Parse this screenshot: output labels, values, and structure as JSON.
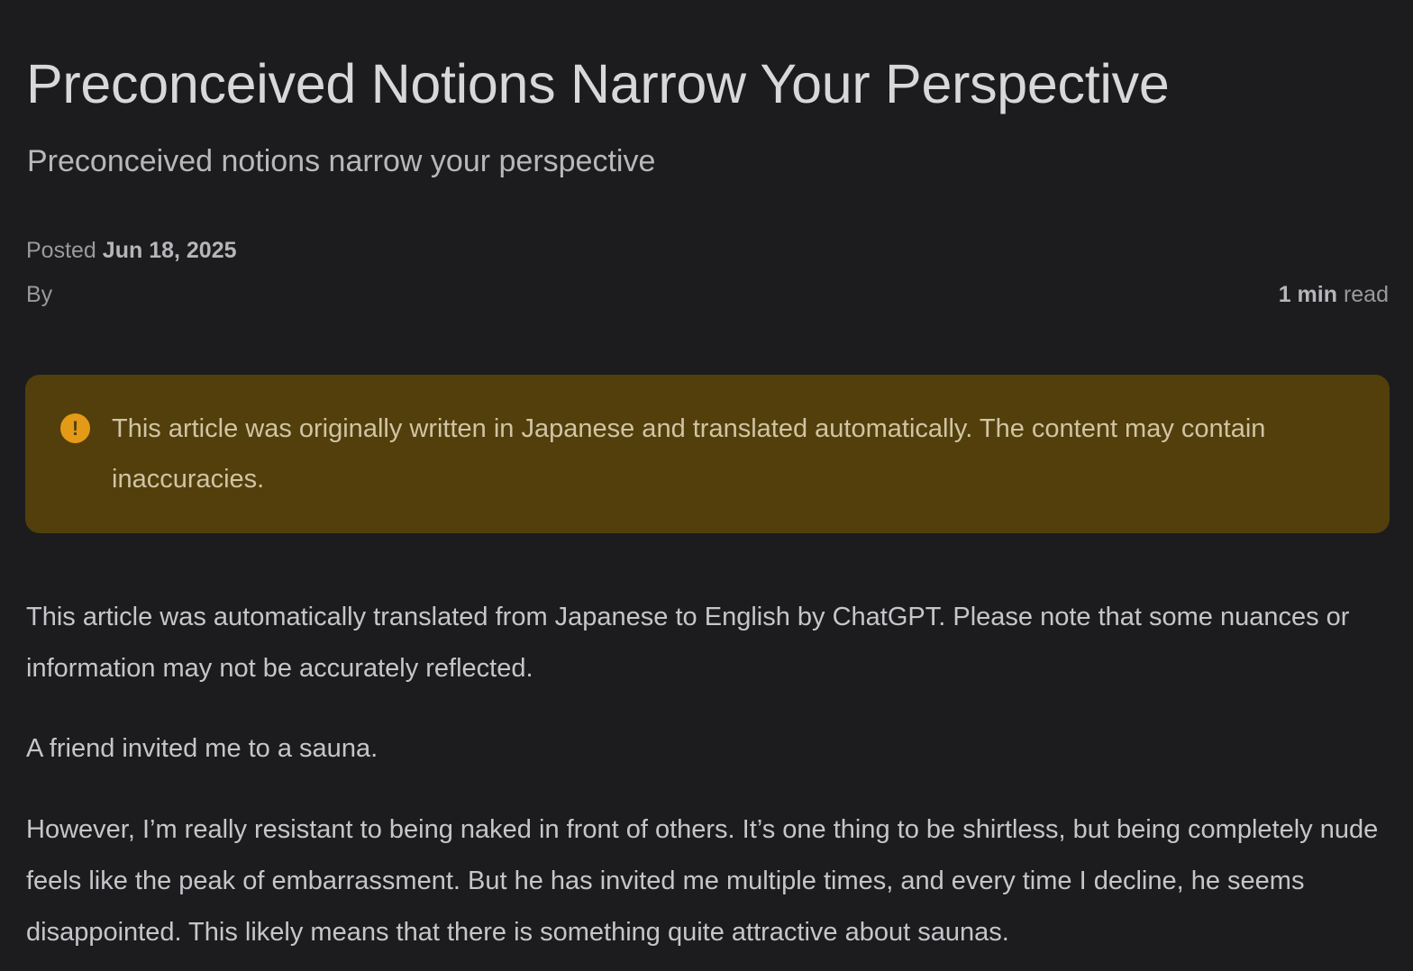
{
  "article": {
    "title": "Preconceived Notions Narrow Your Perspective",
    "subtitle": "Preconceived notions narrow your perspective"
  },
  "meta": {
    "posted_label": "Posted",
    "posted_date": "Jun 18, 2025",
    "by_label": "By",
    "read_time_value": "1 min",
    "read_time_label": "read"
  },
  "notice": {
    "icon": "exclamation-circle-icon",
    "icon_glyph": "!",
    "text": "This article was originally written in Japanese and translated automatically. The content may contain inaccuracies.",
    "background_color": "#523f0c",
    "icon_color": "#e49a16"
  },
  "body": {
    "paragraphs": [
      "This article was automatically translated from Japanese to English by ChatGPT. Please note that some nuances or information may not be accurately reflected.",
      "A friend invited me to a sauna.",
      "However, I’m really resistant to being naked in front of others. It’s one thing to be shirtless, but being completely nude feels like the peak of embarrassment. But he has invited me multiple times, and every time I decline, he seems disappointed. This likely means that there is something quite attractive about saunas."
    ]
  },
  "colors": {
    "background": "#1c1c1e",
    "title_text": "#d8d8da",
    "body_text": "#c6c6ca"
  }
}
